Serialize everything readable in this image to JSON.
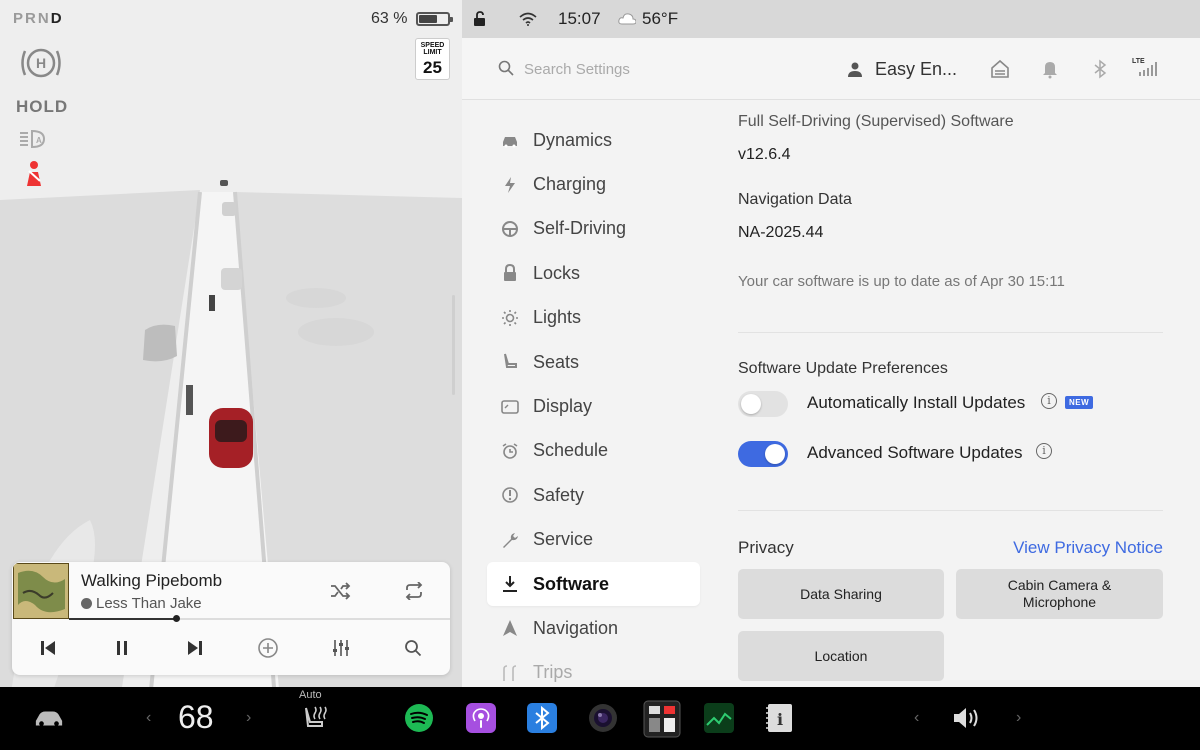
{
  "left_panel": {
    "gear": {
      "letters": [
        "P",
        "R",
        "N",
        "D"
      ],
      "active": "D"
    },
    "battery": {
      "percent_text": "63 %",
      "level": 0.63
    },
    "speed_limit": {
      "label": "SPEED LIMIT",
      "value": "25"
    },
    "hold_label": "HOLD",
    "icons": [
      "hold-icon",
      "auto-headlight-icon",
      "seatbelt-warning-icon"
    ]
  },
  "player": {
    "song": "Walking Pipebomb",
    "artist": "Less Than Jake",
    "progress": 0.28,
    "controls": [
      "shuffle-icon",
      "repeat-icon",
      "previous-icon",
      "pause-icon",
      "next-icon",
      "add-icon",
      "equalizer-icon",
      "search-icon"
    ]
  },
  "status_bar": {
    "time": "15:07",
    "weather": "56°F",
    "icons": [
      "unlocked-icon",
      "wifi-icon",
      "cloud-icon"
    ]
  },
  "header": {
    "search_placeholder": "Search Settings",
    "profile_name": "Easy En...",
    "icons": [
      "home-icon",
      "bell-icon",
      "bluetooth-icon",
      "lte-signal-icon"
    ],
    "lte_label": "LTE"
  },
  "menu": {
    "items": [
      {
        "label": "Dynamics",
        "icon": "car-icon"
      },
      {
        "label": "Charging",
        "icon": "lightning-icon"
      },
      {
        "label": "Self-Driving",
        "icon": "steering-wheel-icon"
      },
      {
        "label": "Locks",
        "icon": "lock-icon"
      },
      {
        "label": "Lights",
        "icon": "sun-icon"
      },
      {
        "label": "Seats",
        "icon": "seat-icon"
      },
      {
        "label": "Display",
        "icon": "display-icon"
      },
      {
        "label": "Schedule",
        "icon": "alarm-clock-icon"
      },
      {
        "label": "Safety",
        "icon": "warning-circle-icon"
      },
      {
        "label": "Service",
        "icon": "wrench-icon"
      },
      {
        "label": "Software",
        "icon": "download-icon"
      },
      {
        "label": "Navigation",
        "icon": "navigation-arrow-icon"
      },
      {
        "label": "Trips",
        "icon": "trips-icon"
      }
    ],
    "active": "Software"
  },
  "software": {
    "fsd_label": "Full Self-Driving (Supervised) Software",
    "fsd_version": "v12.6.4",
    "nav_label": "Navigation Data",
    "nav_version": "NA-2025.44",
    "status_text": "Your car software is up to date as of Apr 30 15:11",
    "prefs_heading": "Software Update Preferences",
    "auto_install_label": "Automatically Install Updates",
    "auto_install_on": false,
    "new_badge": "NEW",
    "advanced_label": "Advanced Software Updates",
    "advanced_on": true,
    "privacy_heading": "Privacy",
    "privacy_link": "View Privacy Notice",
    "privacy_buttons": [
      "Data Sharing",
      "Cabin Camera & Microphone",
      "Location"
    ]
  },
  "dock": {
    "temperature": "68",
    "seat_heat_label": "Auto",
    "apps": [
      "car-icon",
      "seat-heater-icon",
      "spotify-icon",
      "podcasts-icon",
      "bluetooth-icon",
      "dashcam-icon",
      "arcade-icon",
      "stocks-icon",
      "manual-icon"
    ],
    "volume_icon": "volume-icon"
  }
}
